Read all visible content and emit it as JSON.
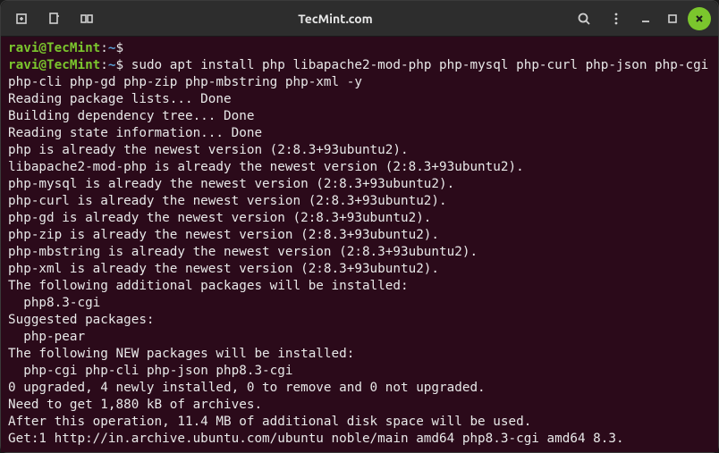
{
  "titlebar": {
    "title": "TecMint.com"
  },
  "terminal": {
    "prompt_user_host": "ravi@TecMint",
    "prompt_sep1": ":",
    "prompt_path": "~",
    "prompt_sep2": "$",
    "command": "sudo apt install php libapache2-mod-php php-mysql php-curl php-json php-cgi php-cli php-gd php-zip php-mbstring php-xml -y",
    "lines": [
      "Reading package lists... Done",
      "Building dependency tree... Done",
      "Reading state information... Done",
      "php is already the newest version (2:8.3+93ubuntu2).",
      "libapache2-mod-php is already the newest version (2:8.3+93ubuntu2).",
      "php-mysql is already the newest version (2:8.3+93ubuntu2).",
      "php-curl is already the newest version (2:8.3+93ubuntu2).",
      "php-gd is already the newest version (2:8.3+93ubuntu2).",
      "php-zip is already the newest version (2:8.3+93ubuntu2).",
      "php-mbstring is already the newest version (2:8.3+93ubuntu2).",
      "php-xml is already the newest version (2:8.3+93ubuntu2).",
      "The following additional packages will be installed:",
      "  php8.3-cgi",
      "Suggested packages:",
      "  php-pear",
      "The following NEW packages will be installed:",
      "  php-cgi php-cli php-json php8.3-cgi",
      "0 upgraded, 4 newly installed, 0 to remove and 0 not upgraded.",
      "Need to get 1,880 kB of archives.",
      "After this operation, 11.4 MB of additional disk space will be used.",
      "Get:1 http://in.archive.ubuntu.com/ubuntu noble/main amd64 php8.3-cgi amd64 8.3."
    ]
  }
}
